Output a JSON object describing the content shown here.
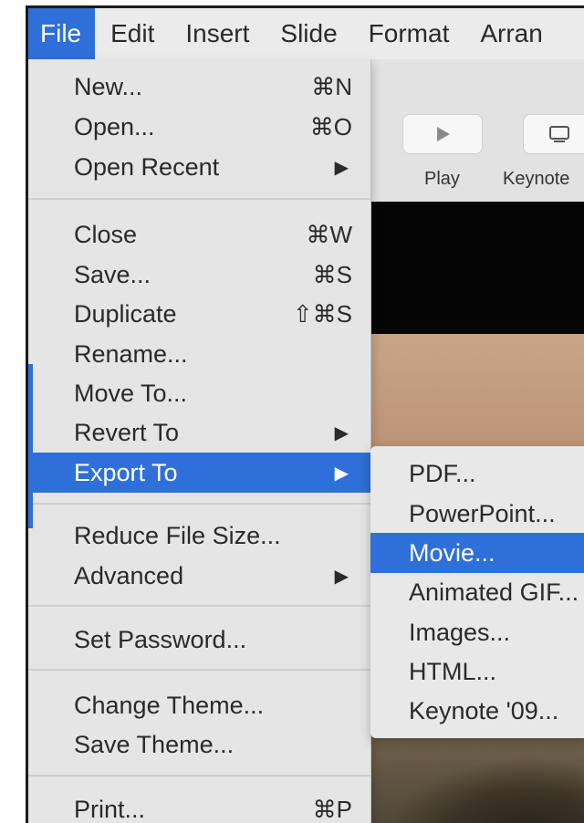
{
  "menubar": {
    "items": [
      "File",
      "Edit",
      "Insert",
      "Slide",
      "Format",
      "Arran"
    ],
    "active": "File"
  },
  "toolbar": {
    "play_label": "Play",
    "keynote_label": "Keynote"
  },
  "file_menu": {
    "items": [
      {
        "label": "New...",
        "shortcut": "⌘N"
      },
      {
        "label": "Open...",
        "shortcut": "⌘O"
      },
      {
        "label": "Open Recent",
        "arrow": "▶"
      },
      {
        "label": "Close",
        "shortcut": "⌘W"
      },
      {
        "label": "Save...",
        "shortcut": "⌘S"
      },
      {
        "label": "Duplicate",
        "shortcut": "⇧⌘S"
      },
      {
        "label": "Rename..."
      },
      {
        "label": "Move To..."
      },
      {
        "label": "Revert To",
        "arrow": "▶"
      },
      {
        "label": "Export To",
        "arrow": "▶",
        "selected": true
      },
      {
        "label": "Reduce File Size..."
      },
      {
        "label": "Advanced",
        "arrow": "▶"
      },
      {
        "label": "Set Password..."
      },
      {
        "label": "Change Theme..."
      },
      {
        "label": "Save Theme..."
      },
      {
        "label": "Print...",
        "shortcut": "⌘P"
      }
    ]
  },
  "export_submenu": {
    "items": [
      {
        "label": "PDF..."
      },
      {
        "label": "PowerPoint..."
      },
      {
        "label": "Movie...",
        "selected": true
      },
      {
        "label": "Animated GIF..."
      },
      {
        "label": "Images..."
      },
      {
        "label": "HTML..."
      },
      {
        "label": "Keynote '09..."
      }
    ]
  },
  "colors": {
    "accent": "#2f6fd9",
    "menu_bg": "#e6e5e5"
  }
}
